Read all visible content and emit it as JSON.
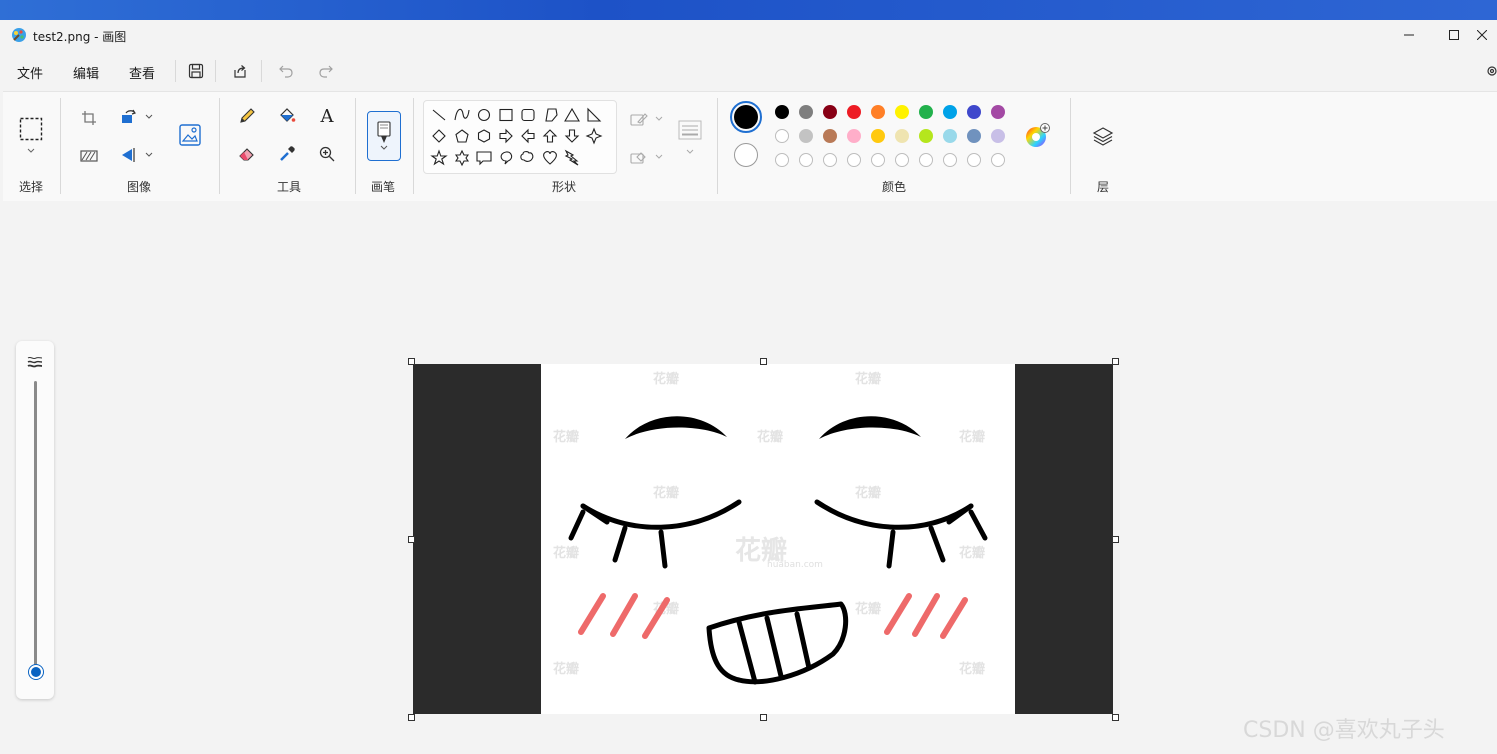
{
  "window": {
    "title": "test2.png - 画图"
  },
  "menu": {
    "items": [
      "文件",
      "编辑",
      "查看"
    ]
  },
  "ribbon": {
    "groups": {
      "select": "选择",
      "image": "图像",
      "tools": "工具",
      "brushes": "画笔",
      "shapes": "形状",
      "colors": "颜色",
      "layers": "层"
    },
    "text_tool_glyph": "A"
  },
  "colors": {
    "primary": "#000000",
    "secondary": "#ffffff",
    "row1": [
      "#000000",
      "#7f7f7f",
      "#880015",
      "#ed1c24",
      "#ff7f27",
      "#fff200",
      "#22b14c",
      "#00a2e8",
      "#3f48cc",
      "#a349a4"
    ],
    "row2": [
      "#ffffff",
      "#c3c3c3",
      "#b97a57",
      "#ffaec9",
      "#ffc90e",
      "#efe4b0",
      "#b5e61d",
      "#99d9ea",
      "#7092be",
      "#c8bfe7"
    ],
    "row3_empty_count": 10
  },
  "canvas": {
    "watermark_main": "花瓣",
    "watermark_sub": "huaban.com",
    "watermark_small": "花瓣"
  },
  "footer": {
    "credit": "CSDN @喜欢丸子头"
  }
}
